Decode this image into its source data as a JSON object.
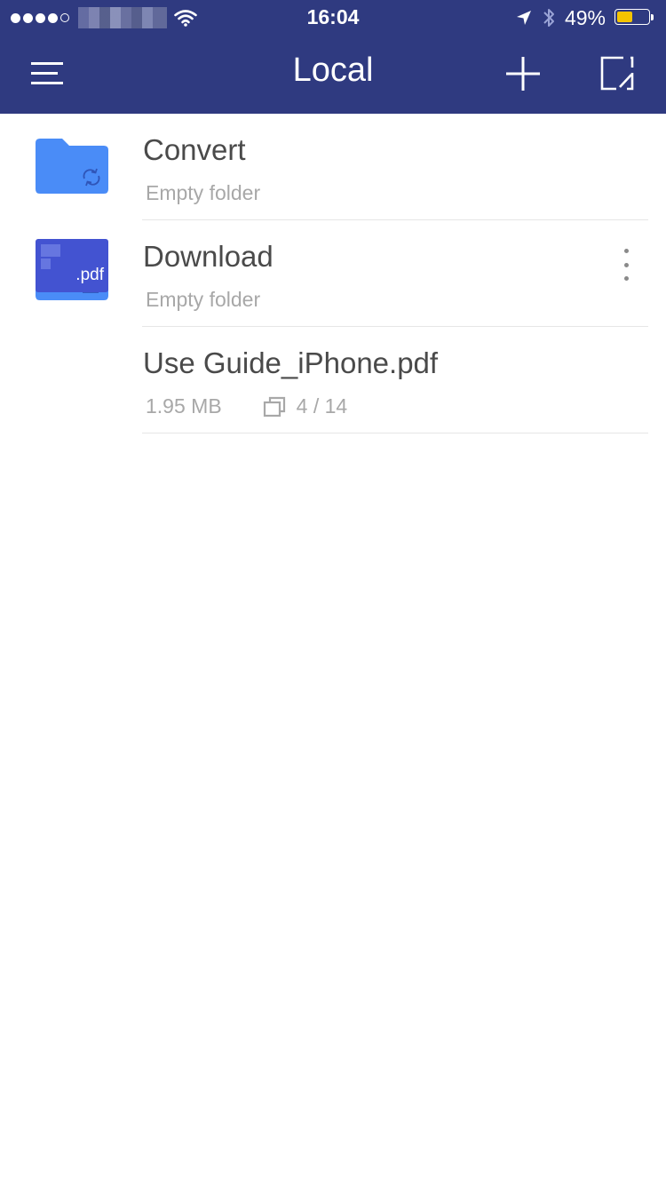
{
  "colors": {
    "header_bg": "#2f3a80",
    "folder_blue": "#4a8cf7",
    "pdf_blue": "#4353d1",
    "battery_fill": "#f5c400"
  },
  "status_bar": {
    "time": "16:04",
    "battery_percent": "49%",
    "battery_level": 0.49,
    "signal_bars_filled": 4,
    "icons": [
      "signal-dots-icon",
      "wifi-icon",
      "location-arrow-icon",
      "bluetooth-icon",
      "battery-icon"
    ]
  },
  "nav": {
    "title": "Local",
    "icons": [
      "menu-icon",
      "plus-icon",
      "edit-icon"
    ]
  },
  "items": [
    {
      "name": "Convert",
      "meta": "Empty folder",
      "icon": "folder-sync-icon"
    },
    {
      "name": "Download",
      "meta": "Empty folder",
      "icon": "folder-download-icon"
    },
    {
      "name": "Use Guide_iPhone.pdf",
      "size": "1.95 MB",
      "pages": "4 / 14",
      "thumb_label": ".pdf",
      "icon": "pdf-file-icon"
    }
  ]
}
